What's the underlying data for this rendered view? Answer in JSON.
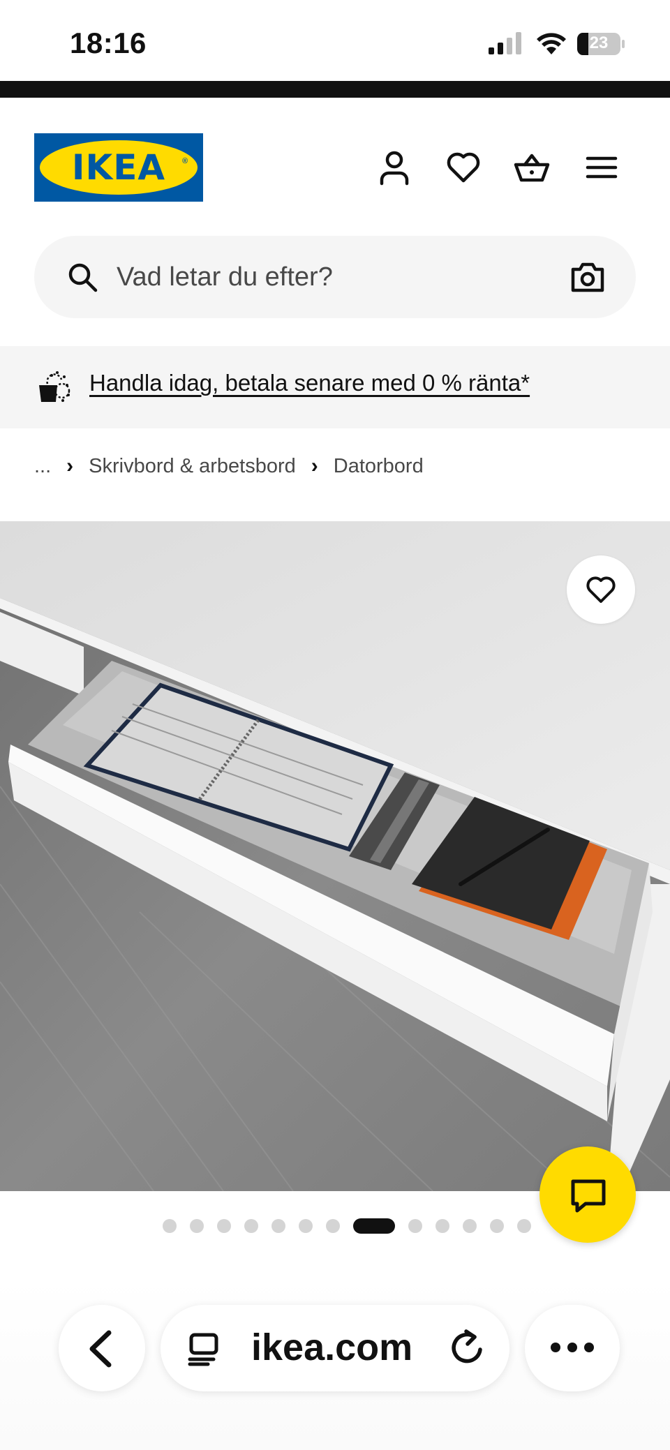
{
  "status_bar": {
    "time": "18:16",
    "battery": "23"
  },
  "header": {
    "logo_text": "IKEA",
    "icons": [
      "account-icon",
      "heart-icon",
      "basket-icon",
      "menu-icon"
    ]
  },
  "search": {
    "placeholder": "Vad letar du efter?",
    "icons": [
      "search-icon",
      "camera-icon"
    ]
  },
  "promo": {
    "text": "Handla idag, betala senare med 0 % ränta*"
  },
  "breadcrumb": {
    "items": [
      "...",
      "Skrivbord & arbetsbord",
      "Datorbord"
    ]
  },
  "carousel": {
    "total_images": 13,
    "active_index": 7
  },
  "browser": {
    "url": "ikea.com"
  },
  "colors": {
    "ikea_blue": "#0058a3",
    "ikea_yellow": "#ffdb00",
    "promo_bg": "#f5f5f5"
  }
}
